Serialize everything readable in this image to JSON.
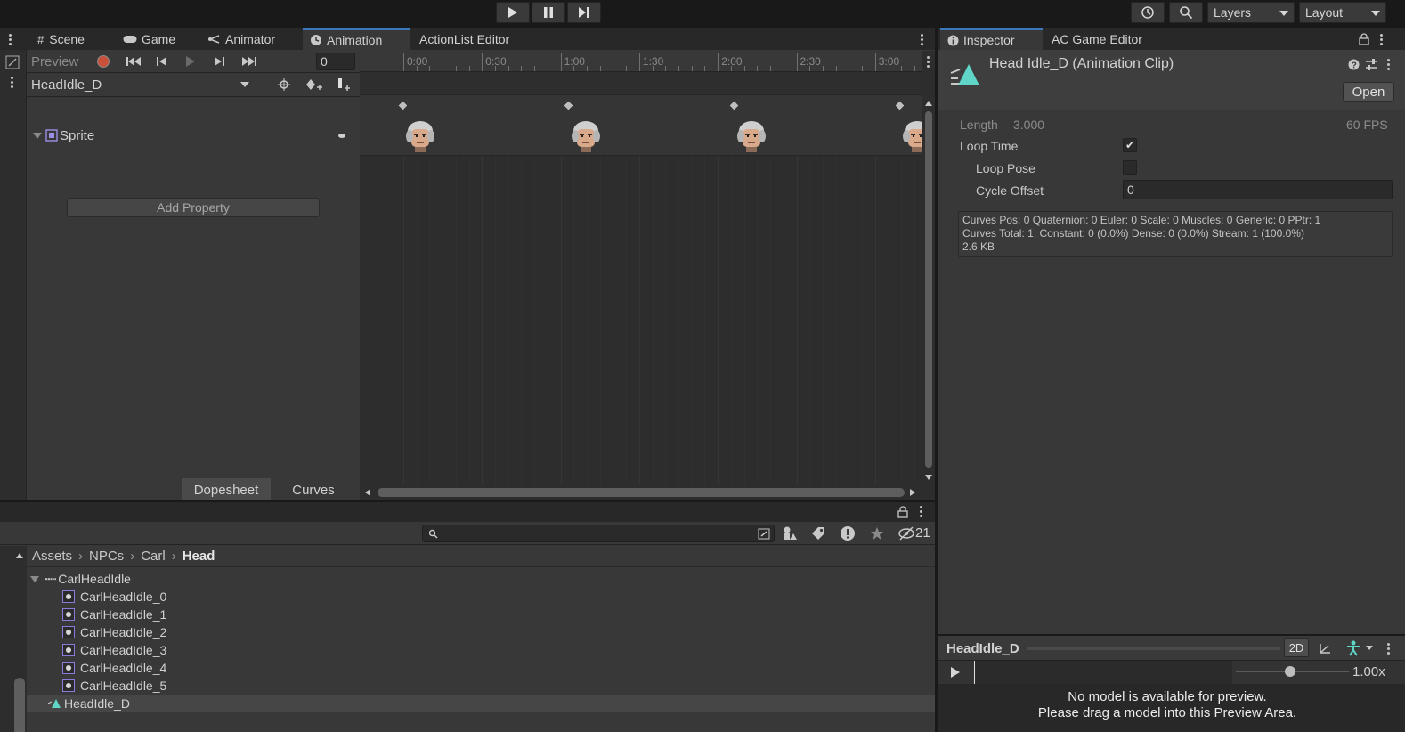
{
  "toolbar": {
    "layers_label": "Layers",
    "layout_label": "Layout"
  },
  "animation_window": {
    "tabs": [
      "Scene",
      "Game",
      "Animator",
      "Animation",
      "ActionList Editor"
    ],
    "preview_label": "Preview",
    "frame_value": "0",
    "clip_name": "HeadIdle_D",
    "property_name": "Sprite",
    "add_property_label": "Add Property",
    "dopesheet_label": "Dopesheet",
    "curves_label": "Curves",
    "time_labels": [
      "0:00",
      "0:30",
      "1:00",
      "1:30",
      "2:00",
      "2:30",
      "3:00"
    ],
    "keyframe_count": 6
  },
  "inspector": {
    "tabs": [
      "Inspector",
      "AC Game Editor"
    ],
    "title": "Head Idle_D (Animation Clip)",
    "open_label": "Open",
    "length_label": "Length",
    "length_value": "3.000",
    "fps_label": "60 FPS",
    "loop_time_label": "Loop Time",
    "loop_time_checked": true,
    "loop_pose_label": "Loop Pose",
    "loop_pose_checked": false,
    "cycle_offset_label": "Cycle Offset",
    "cycle_offset_value": "0",
    "info_line1": "Curves Pos: 0 Quaternion: 0 Euler: 0 Scale: 0 Muscles: 0 Generic: 0 PPtr: 1",
    "info_line2": "Curves Total: 1, Constant: 0 (0.0%) Dense: 0 (0.0%) Stream: 1 (100.0%)",
    "info_line3": "2.6 KB",
    "preview_name": "HeadIdle_D",
    "mode_2d": "2D",
    "speed": "1.00x",
    "no_model_line1": "No model is available for preview.",
    "no_model_line2": "Please drag a model into this Preview Area."
  },
  "project": {
    "hidden_count": "21",
    "breadcrumb": [
      "Assets",
      "NPCs",
      "Carl",
      "Head"
    ],
    "tree": [
      {
        "label": "CarlHeadIdle",
        "type": "sheet"
      },
      {
        "label": "CarlHeadIdle_0",
        "type": "sprite"
      },
      {
        "label": "CarlHeadIdle_1",
        "type": "sprite"
      },
      {
        "label": "CarlHeadIdle_2",
        "type": "sprite"
      },
      {
        "label": "CarlHeadIdle_3",
        "type": "sprite"
      },
      {
        "label": "CarlHeadIdle_4",
        "type": "sprite"
      },
      {
        "label": "CarlHeadIdle_5",
        "type": "sprite"
      },
      {
        "label": "HeadIdle_D",
        "type": "anim"
      }
    ]
  },
  "colors": {
    "accent": "#3a79bb",
    "anim_icon": "#5fd6c8",
    "record": "#c9503a"
  }
}
